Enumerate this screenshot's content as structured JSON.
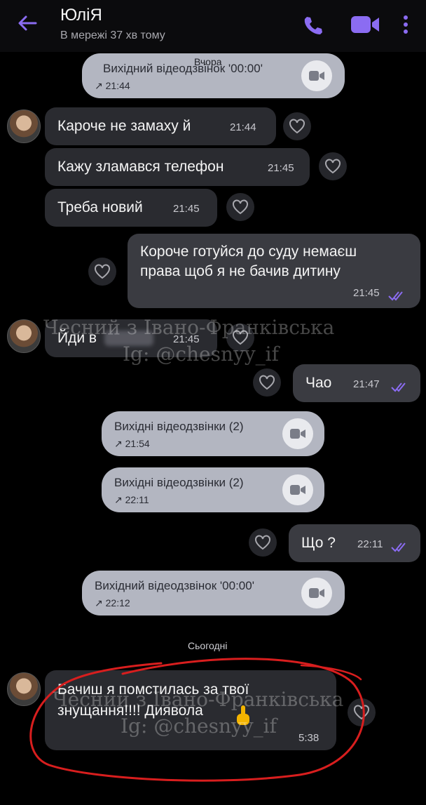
{
  "header": {
    "title": "ЮліЯ",
    "status": "В мережі 37 хв тому"
  },
  "dates": {
    "yesterday": "Вчора",
    "today": "Сьогодні"
  },
  "calls": [
    {
      "title": "Вихідний відеодзвінок '00:00'",
      "time": "↗ 21:44"
    },
    {
      "title": "Вихідні відеодзвінки (2)",
      "time": "↗ 21:54"
    },
    {
      "title": "Вихідні відеодзвінки (2)",
      "time": "↗ 22:11"
    },
    {
      "title": "Вихідний відеодзвінок '00:00'",
      "time": "↗ 22:12"
    }
  ],
  "messages": {
    "m1": {
      "text": "Кароче не замаху й",
      "time": "21:44"
    },
    "m2": {
      "text": "Кажу зламався телефон",
      "time": "21:45"
    },
    "m3": {
      "text": "Треба новий",
      "time": "21:45"
    },
    "m4": {
      "line1": "Короче готуйся до суду немаєш",
      "line2": "права щоб я не бачив дитину",
      "time": "21:45"
    },
    "m5": {
      "text": "Йди в",
      "time": "21:45"
    },
    "m6": {
      "text": "Чао",
      "time": "21:47"
    },
    "m7": {
      "text": "Що ?",
      "time": "22:11"
    },
    "m8": {
      "line1": "Бачиш я помстилась за твої",
      "line2": "знущання!!!! Диявола",
      "time": "5:38"
    }
  },
  "watermark": {
    "line1": "Чесний з Івано-Франківська",
    "line2": "Ig: @chesnyy_if"
  },
  "colors": {
    "accent": "#8b6cf2",
    "incoming_bubble": "#2a2b30",
    "outgoing_bubble": "#3a3b41",
    "call_bubble": "#b3b6c1",
    "annotation_circle": "#d81e1e"
  }
}
